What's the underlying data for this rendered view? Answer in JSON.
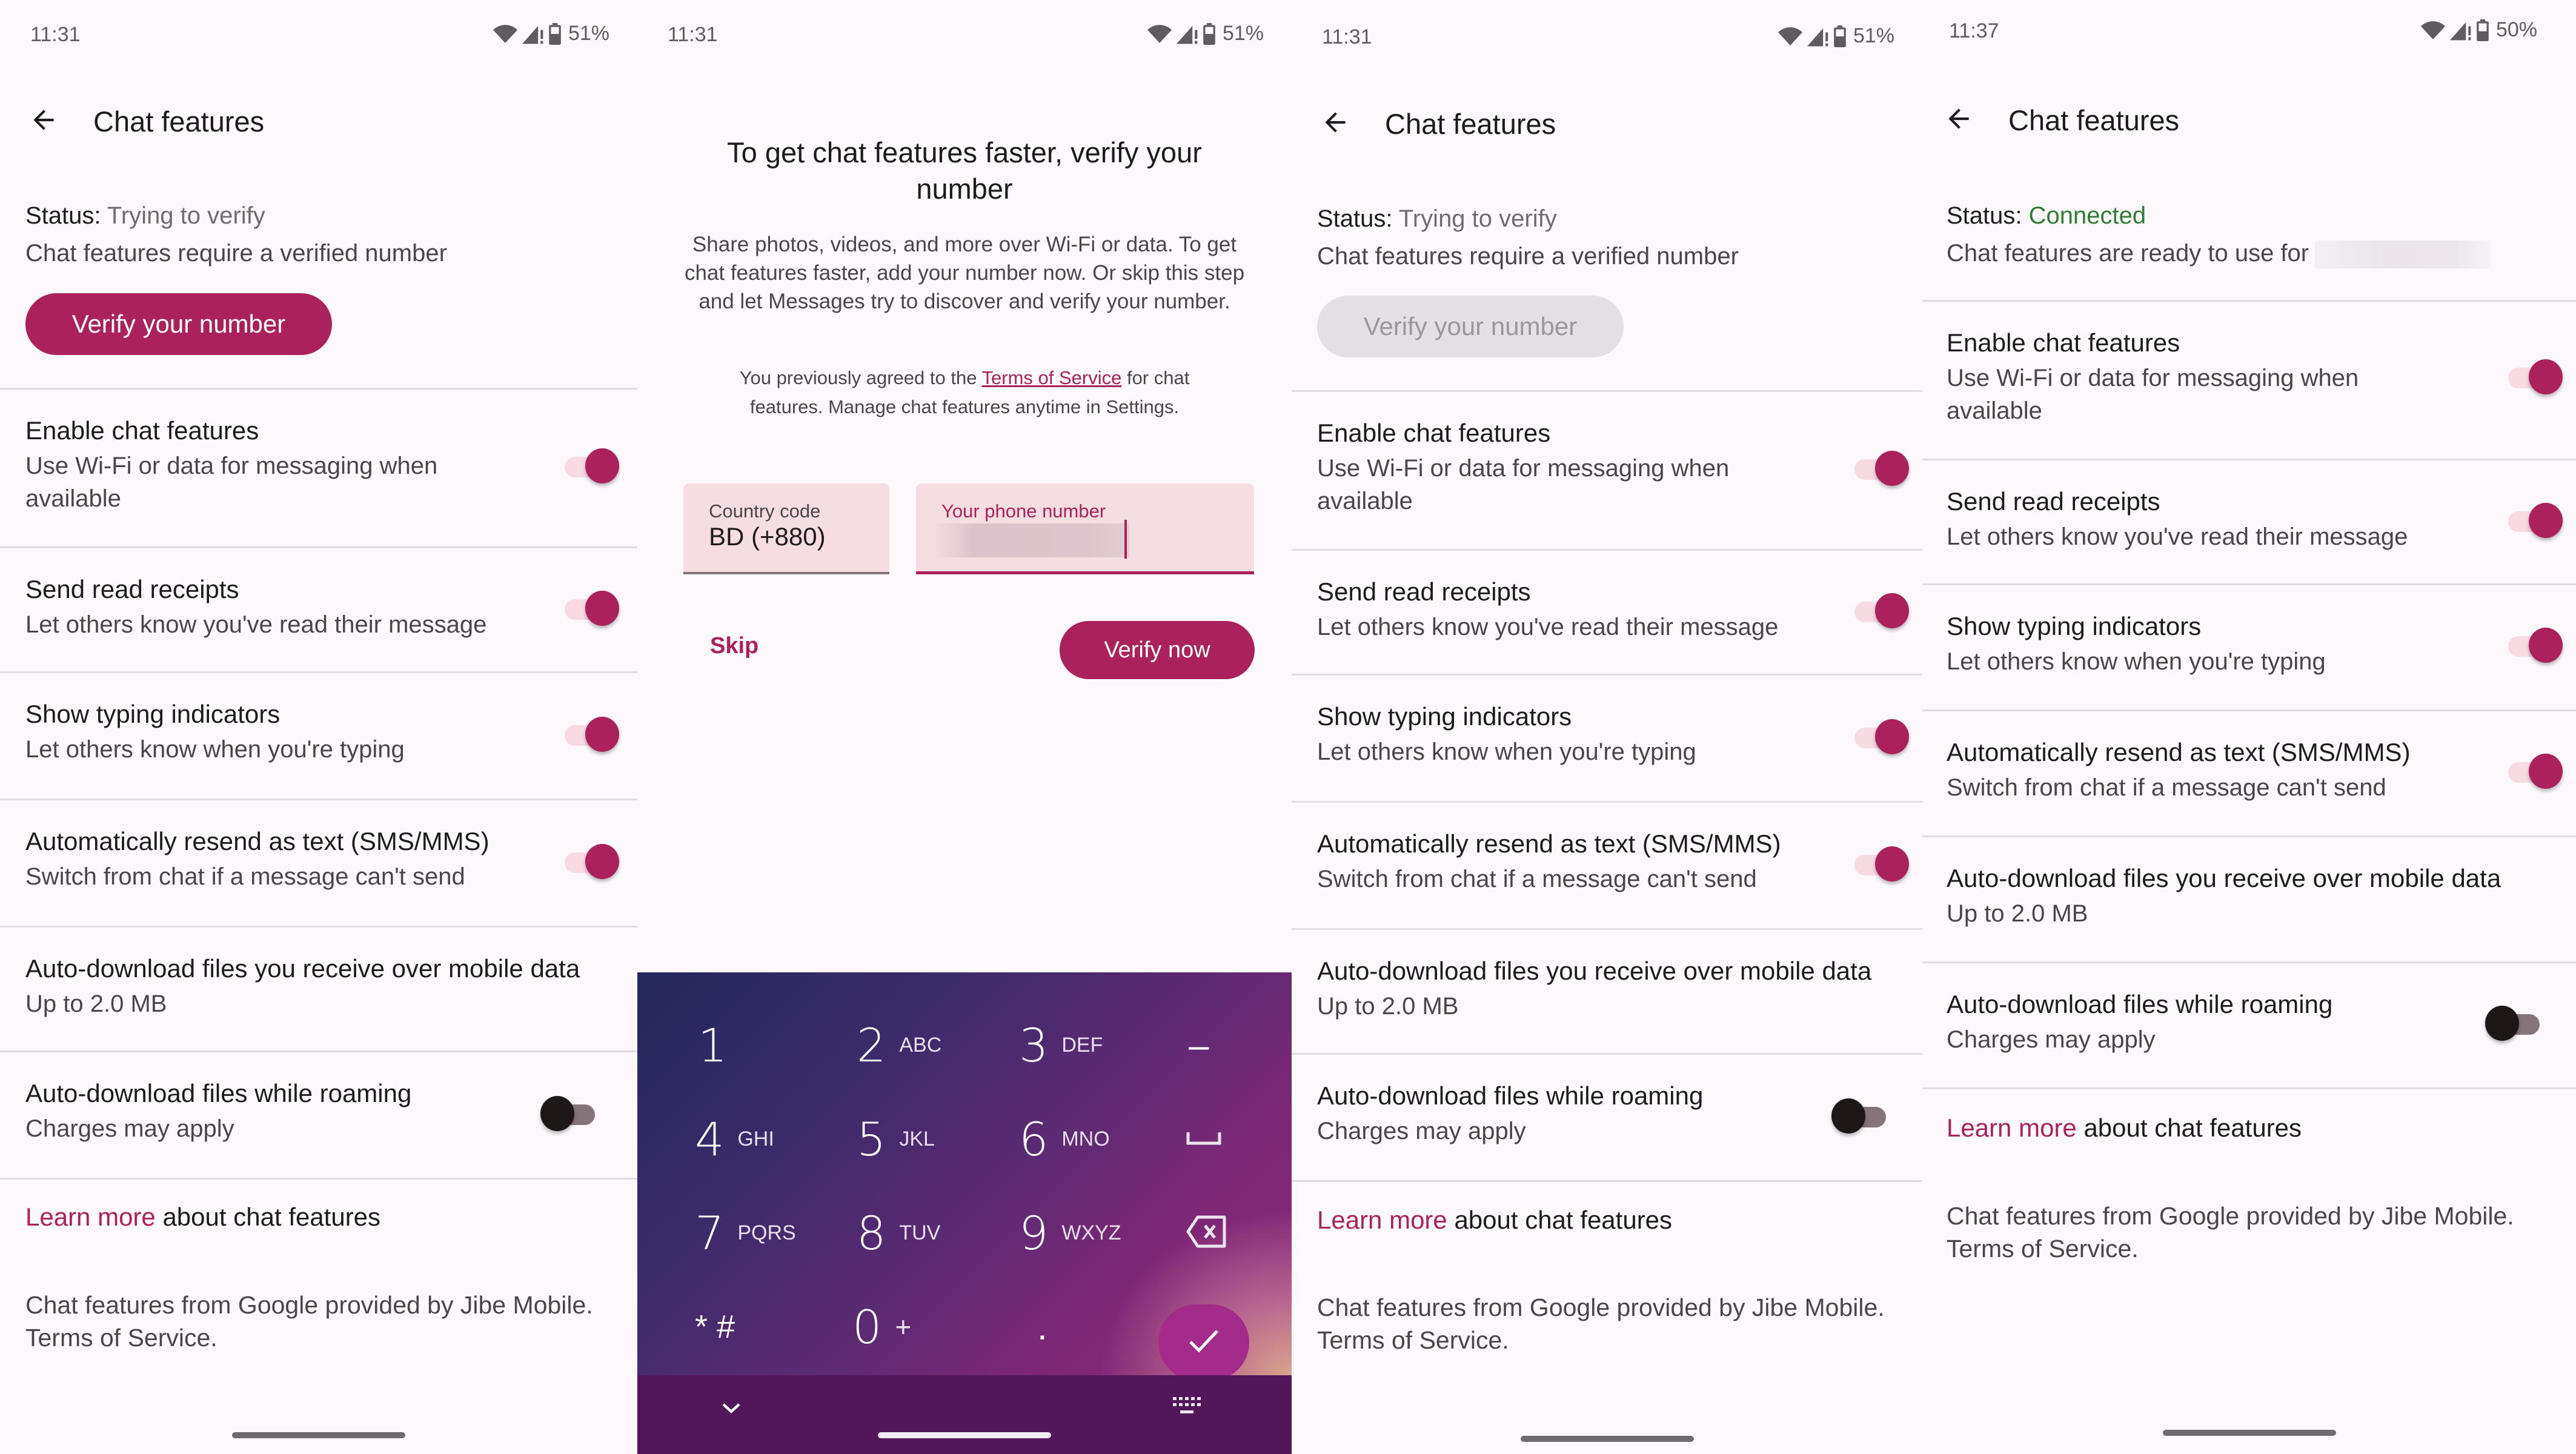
{
  "colors": {
    "accent": "#aa215c",
    "connected": "#2e7d32",
    "background": "#fdf8fc",
    "toggle_track_on": "#f8dae3",
    "toggle_thumb_off": "#1d1718"
  },
  "screens": [
    {
      "status_bar": {
        "time": "11:31",
        "battery": "51%",
        "icons": [
          "wifi-icon",
          "signal-icon",
          "battery-icon"
        ]
      },
      "app_bar": {
        "back_icon": "arrow-back-icon",
        "title": "Chat features"
      },
      "status": {
        "label": "Status:",
        "value": "Trying to verify",
        "description": "Chat features require a verified number"
      },
      "verify_button": {
        "label": "Verify your number",
        "state": "enabled"
      },
      "settings": [
        {
          "title": "Enable chat features",
          "subtitle": "Use Wi-Fi or data for messaging when available",
          "toggle": true
        },
        {
          "title": "Send read receipts",
          "subtitle": "Let others know you've read their message",
          "toggle": true
        },
        {
          "title": "Show typing indicators",
          "subtitle": "Let others know when you're typing",
          "toggle": true
        },
        {
          "title": "Automatically resend as text (SMS/MMS)",
          "subtitle": "Switch from chat if a message can't send",
          "toggle": true
        },
        {
          "title": "Auto-download files you receive over mobile data",
          "subtitle": "Up to 2.0 MB",
          "toggle": null
        },
        {
          "title": "Auto-download files while roaming",
          "subtitle": "Charges may apply",
          "toggle": false
        }
      ],
      "learn_more": {
        "link": "Learn more",
        "rest": " about chat features"
      },
      "footer": "Chat features from Google provided by Jibe Mobile. Terms of Service."
    },
    {
      "status_bar": {
        "time": "11:31",
        "battery": "51%",
        "icons": [
          "wifi-icon",
          "signal-icon",
          "battery-icon"
        ]
      },
      "dialog": {
        "title": "To get chat features faster, verify your number",
        "body": "Share photos, videos, and more over Wi-Fi or data. To get chat features faster, add your number now. Or skip this step and let Messages try to discover and verify your number.",
        "terms_prefix": "You previously agreed to the ",
        "terms_link": "Terms of Service",
        "terms_suffix": " for chat features. Manage chat features anytime in Settings.",
        "country_code_label": "Country code",
        "country_code_value": "BD (+880)",
        "phone_label": "Your phone number",
        "phone_value_visible": ")",
        "skip_label": "Skip",
        "verify_now_label": "Verify now"
      },
      "keypad": {
        "keys": [
          {
            "digit": "1",
            "letters": ""
          },
          {
            "digit": "2",
            "letters": "ABC"
          },
          {
            "digit": "3",
            "letters": "DEF"
          },
          {
            "digit": "–",
            "letters": "",
            "name": "dash-key"
          },
          {
            "digit": "4",
            "letters": "GHI"
          },
          {
            "digit": "5",
            "letters": "JKL"
          },
          {
            "digit": "6",
            "letters": "MNO"
          },
          {
            "digit": "␣",
            "letters": "",
            "name": "space-key"
          },
          {
            "digit": "7",
            "letters": "PQRS"
          },
          {
            "digit": "8",
            "letters": "TUV"
          },
          {
            "digit": "9",
            "letters": "WXYZ"
          },
          {
            "digit": "⌫",
            "letters": "",
            "name": "backspace-key"
          },
          {
            "digit": "* #",
            "letters": "",
            "name": "symbols-key"
          },
          {
            "digit": "0",
            "letters": "+"
          },
          {
            "digit": ".",
            "letters": "",
            "name": "period-key"
          }
        ],
        "enter_icon": "check-icon",
        "nav_icons": [
          "chevron-down-icon",
          "keyboard-icon"
        ]
      }
    },
    {
      "status_bar": {
        "time": "11:31",
        "battery": "51%",
        "icons": [
          "wifi-icon",
          "signal-icon",
          "battery-icon"
        ]
      },
      "app_bar": {
        "back_icon": "arrow-back-icon",
        "title": "Chat features"
      },
      "status": {
        "label": "Status:",
        "value": "Trying to verify",
        "description": "Chat features require a verified number"
      },
      "verify_button": {
        "label": "Verify your number",
        "state": "disabled"
      },
      "settings": [
        {
          "title": "Enable chat features",
          "subtitle": "Use Wi-Fi or data for messaging when available",
          "toggle": true
        },
        {
          "title": "Send read receipts",
          "subtitle": "Let others know you've read their message",
          "toggle": true
        },
        {
          "title": "Show typing indicators",
          "subtitle": "Let others know when you're typing",
          "toggle": true
        },
        {
          "title": "Automatically resend as text (SMS/MMS)",
          "subtitle": "Switch from chat if a message can't send",
          "toggle": true
        },
        {
          "title": "Auto-download files you receive over mobile data",
          "subtitle": "Up to 2.0 MB",
          "toggle": null
        },
        {
          "title": "Auto-download files while roaming",
          "subtitle": "Charges may apply",
          "toggle": false
        }
      ],
      "learn_more": {
        "link": "Learn more",
        "rest": " about chat features"
      },
      "footer": "Chat features from Google provided by Jibe Mobile. Terms of Service."
    },
    {
      "status_bar": {
        "time": "11:37",
        "battery": "50%",
        "icons": [
          "wifi-icon",
          "signal-icon",
          "battery-icon"
        ]
      },
      "app_bar": {
        "back_icon": "arrow-back-icon",
        "title": "Chat features"
      },
      "status": {
        "label": "Status:",
        "value": "Connected",
        "description": "Chat features are ready to use for"
      },
      "settings": [
        {
          "title": "Enable chat features",
          "subtitle": "Use Wi-Fi or data for messaging when available",
          "toggle": true
        },
        {
          "title": "Send read receipts",
          "subtitle": "Let others know you've read their message",
          "toggle": true
        },
        {
          "title": "Show typing indicators",
          "subtitle": "Let others know when you're typing",
          "toggle": true
        },
        {
          "title": "Automatically resend as text (SMS/MMS)",
          "subtitle": "Switch from chat if a message can't send",
          "toggle": true
        },
        {
          "title": "Auto-download files you receive over mobile data",
          "subtitle": "Up to 2.0 MB",
          "toggle": null
        },
        {
          "title": "Auto-download files while roaming",
          "subtitle": "Charges may apply",
          "toggle": false
        }
      ],
      "learn_more": {
        "link": "Learn more",
        "rest": " about chat features"
      },
      "footer": "Chat features from Google provided by Jibe Mobile. Terms of Service."
    }
  ]
}
